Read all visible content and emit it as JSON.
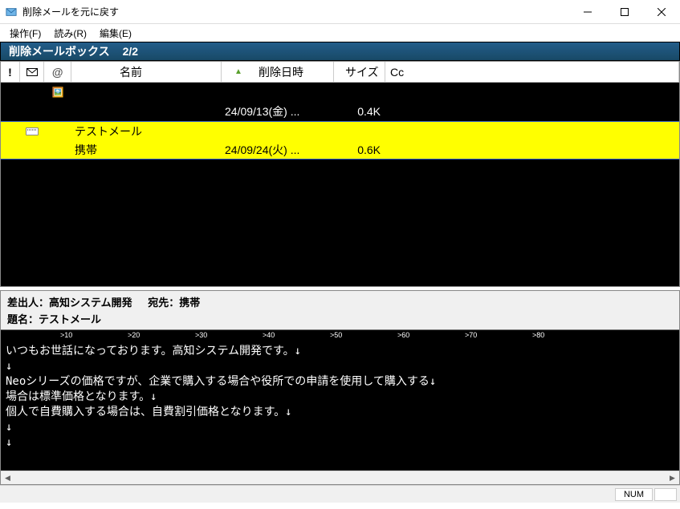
{
  "window": {
    "title": "削除メールを元に戻す"
  },
  "menu": {
    "file": "操作(F)",
    "read": "読み(R)",
    "edit": "編集(E)"
  },
  "header": {
    "title": "削除メールボックス",
    "count": "2/2"
  },
  "columns": {
    "name": "名前",
    "date": "削除日時",
    "size": "サイズ",
    "cc": "Cc"
  },
  "rows": [
    {
      "name1": "",
      "name2": "",
      "date": "24/09/13(金) ...",
      "size": "0.4K",
      "hasMailIcon": false,
      "hasAttach": true,
      "selected": false
    },
    {
      "name1": "テストメール",
      "name2": "携帯",
      "date": "24/09/24(火) ...",
      "size": "0.6K",
      "hasMailIcon": true,
      "hasAttach": false,
      "selected": true
    }
  ],
  "preview": {
    "fromLabel": "差出人：",
    "from": "高知システム開発",
    "toLabel": "宛先：",
    "to": "携帯",
    "subjectLabel": "題名：",
    "subject": "テストメール",
    "bodyLines": [
      "いつもお世話になっております。高知システム開発です。↓",
      "↓",
      "Neoシリーズの価格ですが、企業で購入する場合や役所での申請を使用して購入する↓",
      "場合は標準価格となります。↓",
      "個人で自費購入する場合は、自費割引価格となります。↓",
      "↓",
      "↓"
    ]
  },
  "ruler": [
    ">10",
    ">20",
    ">30",
    ">40",
    ">50",
    ">60",
    ">70",
    ">80"
  ],
  "status": {
    "num": "NUM"
  }
}
